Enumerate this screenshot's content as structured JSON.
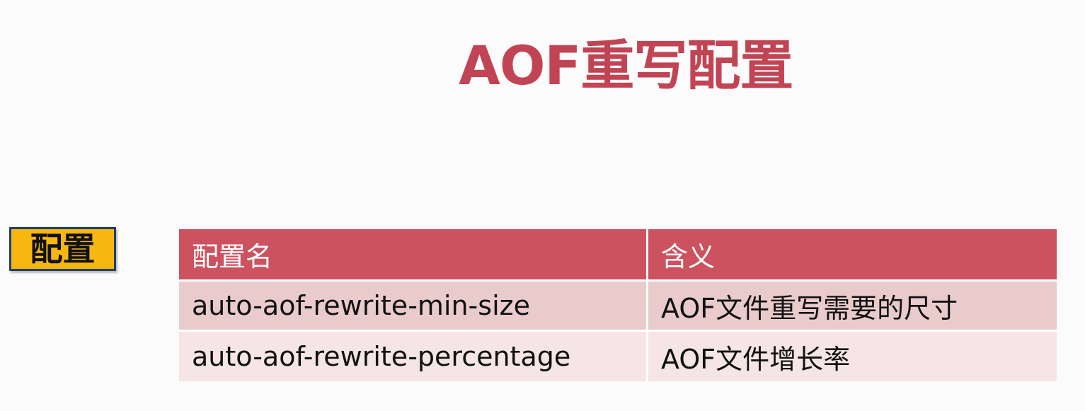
{
  "slide": {
    "title": "AOF重写配置"
  },
  "tag": {
    "label": "配置"
  },
  "table": {
    "headers": [
      "配置名",
      "含义"
    ],
    "rows": [
      [
        "auto-aof-rewrite-min-size",
        "AOF文件重写需要的尺寸"
      ],
      [
        "auto-aof-rewrite-percentage",
        "AOF文件增长率"
      ]
    ]
  },
  "colors": {
    "title": "#c14455",
    "header_bg": "#cd525f",
    "row_odd_bg": "#eacbcc",
    "row_even_bg": "#f5e5e6",
    "tag_bg": "#f7b70f",
    "tag_border": "#1f3f6b"
  }
}
